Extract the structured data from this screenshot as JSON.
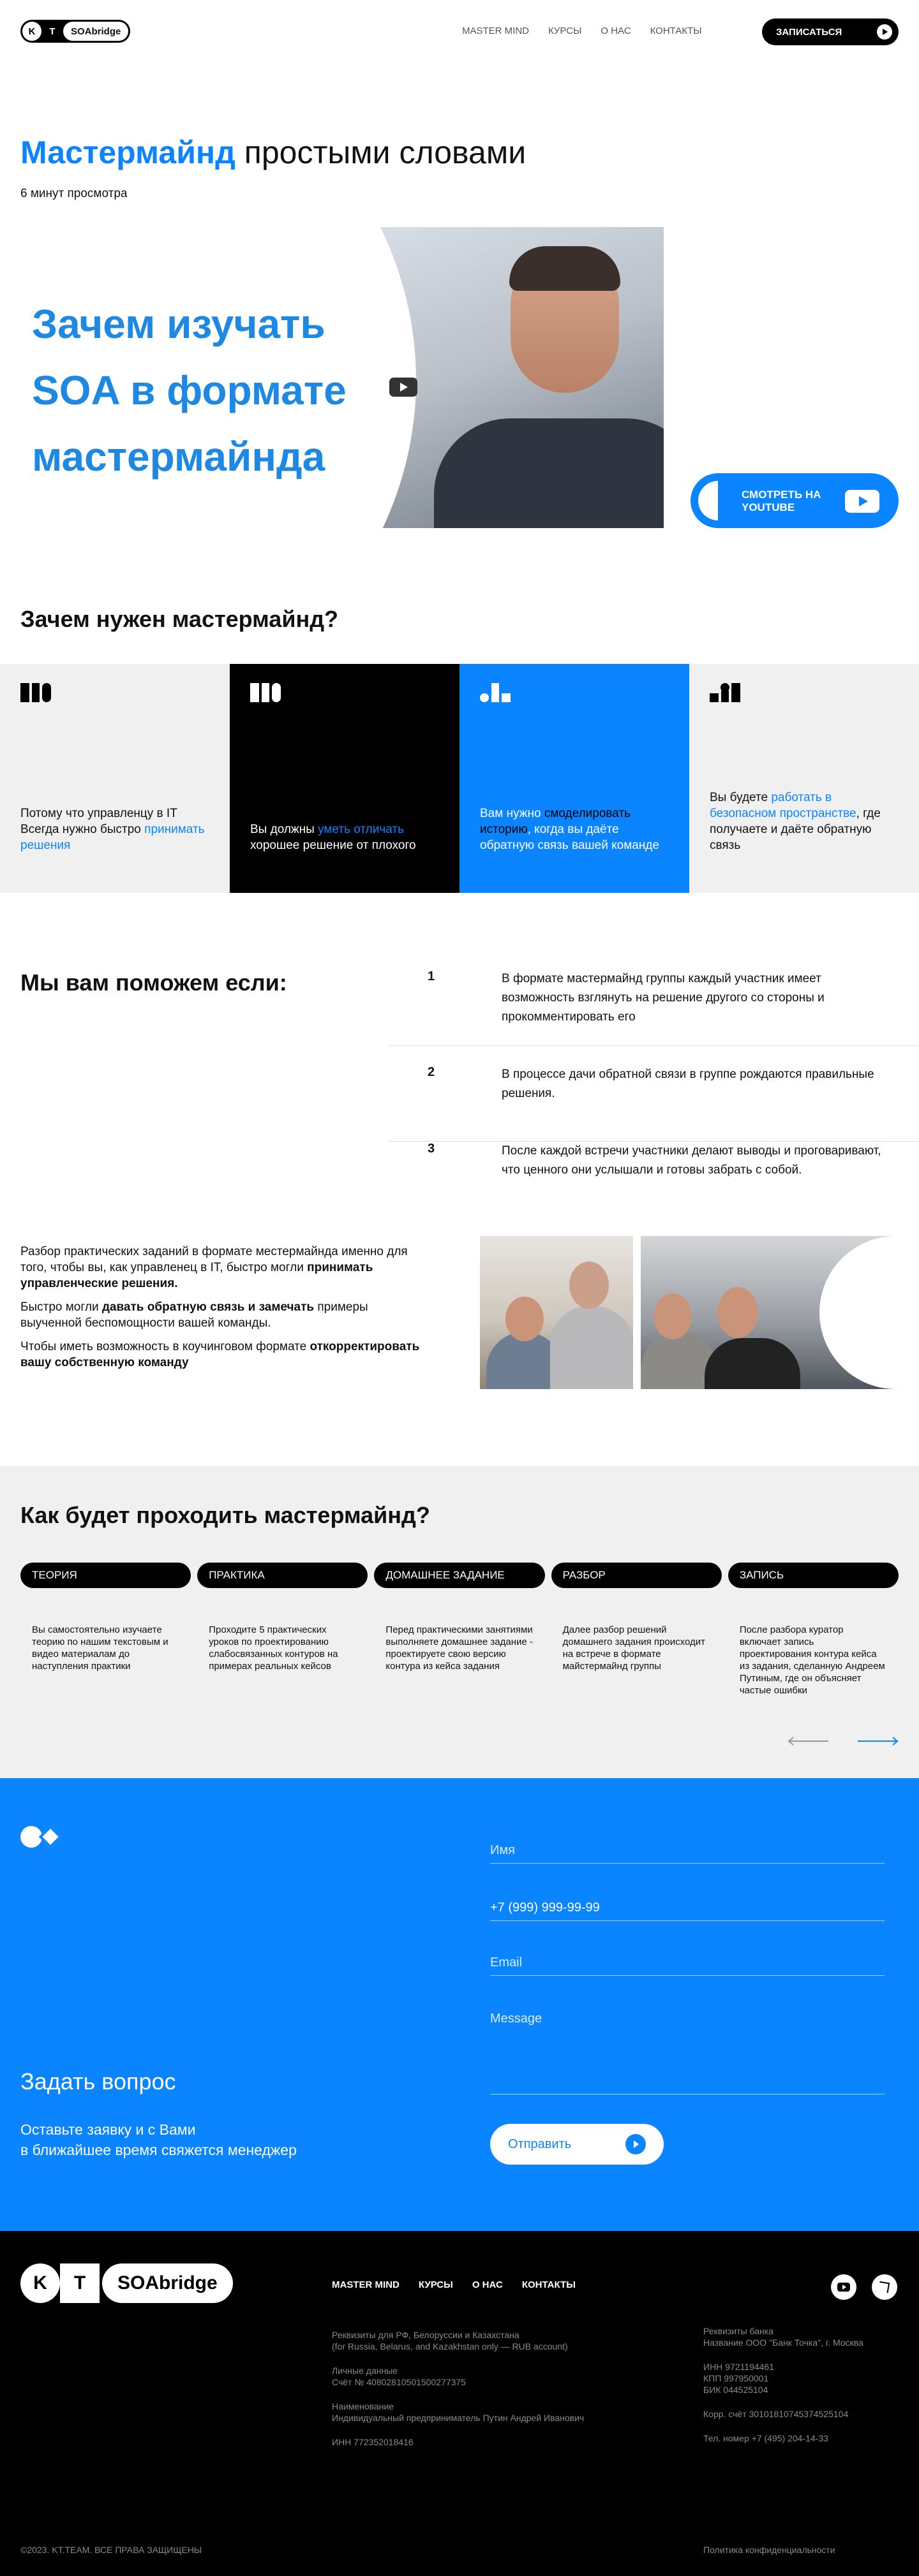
{
  "header": {
    "logo": {
      "k": "K",
      "t": "T",
      "word": "SOAbridge"
    },
    "nav": [
      "MASTER MIND",
      "КУРСЫ",
      "О НАС",
      "КОНТАКТЫ"
    ],
    "cta": "ЗАПИСАТЬСЯ"
  },
  "hero": {
    "title_accent": "Мастермайнд",
    "title_rest": " простыми словами",
    "subtitle": "6 минут просмотра",
    "video_lines": [
      "Зачем изучать",
      "SOA в формате",
      "мастермайнда"
    ],
    "youtube_button": "СМОТРЕТЬ НА YOUTUBE"
  },
  "why": {
    "title": "Зачем нужен мастермайнд?",
    "cards": [
      {
        "pre": "Потому что управленцу в IT Всегда нужно быстро ",
        "hl": "принимать решения",
        "post": ""
      },
      {
        "pre": "Вы должны ",
        "hl": "уметь отличать",
        "post": " хорошее решение от плохого"
      },
      {
        "pre": "Вам нужно ",
        "hl": "смоделировать историю",
        "post": ", когда вы даёте обратную связь вашей команде"
      },
      {
        "pre": "Вы будете ",
        "hl": "работать в безопасном пространстве",
        "post": ", где получаете и даёте обратную связь"
      }
    ]
  },
  "help": {
    "title": "Мы вам поможем если:",
    "items": [
      {
        "num": "1",
        "text": "В формате мастермайнд группы каждый участник имеет возможность взглянуть на решение другого со стороны и прокомментировать его"
      },
      {
        "num": "2",
        "text": "В процессе дачи обратной связи в группе рождаются правильные решения."
      },
      {
        "num": "3",
        "text": "После каждой встречи участники делают выводы и проговаривают, что ценного они услышали и готовы забрать с собой."
      }
    ]
  },
  "about": {
    "p1_pre": "Разбор практических заданий в формате местермайнда именно для того, чтобы вы, как управленец в IT, быстро могли ",
    "p1_bold": "принимать управленческие решения.",
    "p2_pre": "Быстро могли ",
    "p2_bold": "давать обратную связь и замечать",
    "p2_post": " примеры выученной беспомощности вашей команды.",
    "p3_pre": "Чтобы иметь возможность в коучинговом формате ",
    "p3_bold": "откорректировать вашу собственную команду"
  },
  "how": {
    "title": "Как будет проходить мастермайнд?",
    "tabs": [
      "ТЕОРИЯ",
      "ПРАКТИКА",
      "ДОМАШНЕЕ ЗАДАНИЕ",
      "РАЗБОР",
      "ЗАПИСЬ"
    ],
    "steps": [
      "Вы самостоятельно изучаете теорию по нашим текстовым и видео материалам до наступления практики",
      "Проходите 5 практических уроков по проектированию слабосвязанных контуров на примерах реальных кейсов",
      "Перед практическими занятиями выполняете домашнее задание - проектируете свою версию контура из кейса задания",
      "Далее разбор решений домашнего задания происходит на встрече в формате майстермайнд группы",
      "После разбора куратор включает запись проектирования контура кейса из задания, сделанную Андреем Путиным, где он объясняет частые ошибки"
    ]
  },
  "contact": {
    "title": "Задать вопрос",
    "lead_1": "Оставьте заявку и с Вами",
    "lead_2": "в ближайшее время свяжется менеджер",
    "name_placeholder": "Имя",
    "phone_value": "+7  (999) 999-99-99",
    "email_placeholder": "Email",
    "message_placeholder": "Message",
    "send": "Отправить"
  },
  "footer": {
    "logo": {
      "k": "K",
      "t": "T",
      "word": "SOAbridge"
    },
    "nav": [
      "MASTER MIND",
      "КУРСЫ",
      "О НАС",
      "КОНТАКТЫ"
    ],
    "left": [
      [
        "Реквизиты для РФ, Белоруссии и Казахстана",
        "(for Russia, Belarus, and Kazakhstan only — RUB account)"
      ],
      [
        "Личные данные",
        "Счёт № 40802810501500277375"
      ],
      [
        "Наименование",
        "Индивидуальный предприниматель Путин Андрей Иванович"
      ],
      [
        "ИНН 772352018416"
      ]
    ],
    "right": [
      [
        "Реквизиты банка",
        "Название ООО \"Банк Точка\", г. Москва"
      ],
      [
        "ИНН 9721194461",
        "КПП 997950001",
        "БИК 044525104"
      ],
      [
        "Корр. счёт 30101810745374525104"
      ],
      [
        "Тел. номер +7 (495) 204-14-33"
      ]
    ],
    "copyright": "©2023. KT.TEAM. ВСЕ  ПРАВА ЗАЩИЩЕНЫ",
    "policy": "Политика конфиденциальности"
  },
  "colors": {
    "accent": "#0a84ff",
    "dark": "#000000",
    "light": "#f0f0f0"
  }
}
